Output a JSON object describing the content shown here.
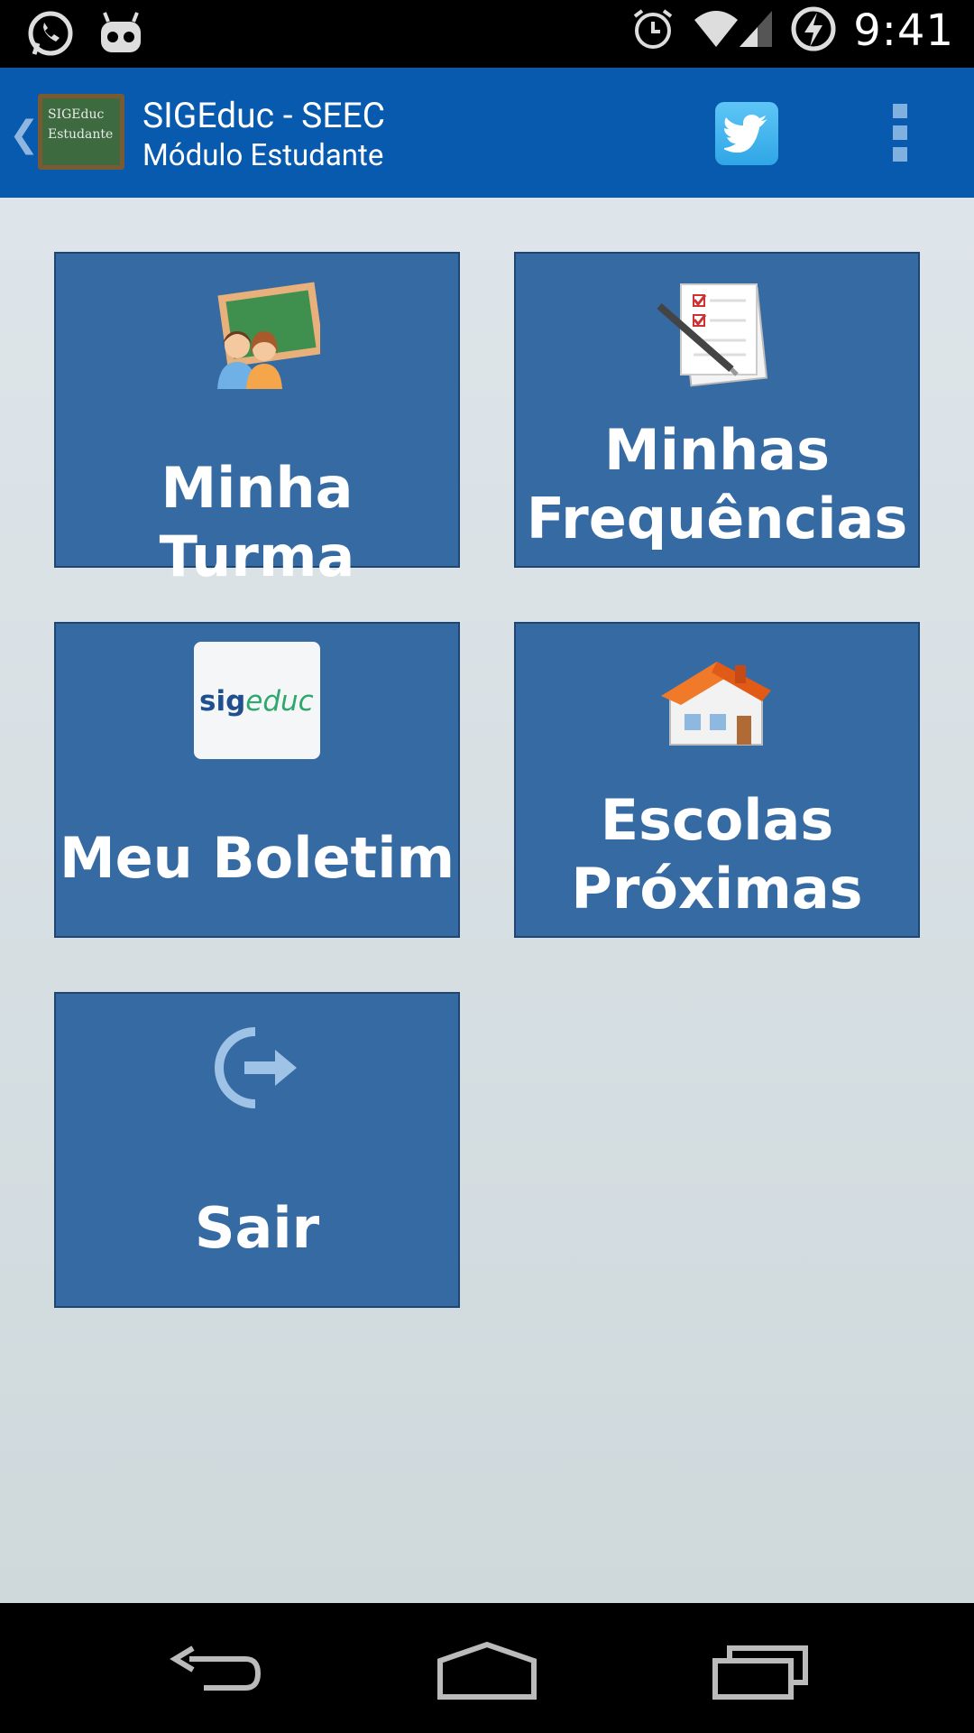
{
  "status_bar": {
    "time": "9:41"
  },
  "app_bar": {
    "icon_text_1": "SIGEduc",
    "icon_text_2": "Estudante",
    "title": "SIGEduc - SEEC",
    "subtitle": "Módulo Estudante"
  },
  "tiles": [
    {
      "label": "Minha Turma"
    },
    {
      "label_line1": "Minhas",
      "label_line2": "Frequências"
    },
    {
      "label": "Meu Boletim",
      "logo_text_1": "sig",
      "logo_text_2": "educ"
    },
    {
      "label_line1": "Escolas",
      "label_line2": "Próximas"
    },
    {
      "label": "Sair"
    }
  ]
}
